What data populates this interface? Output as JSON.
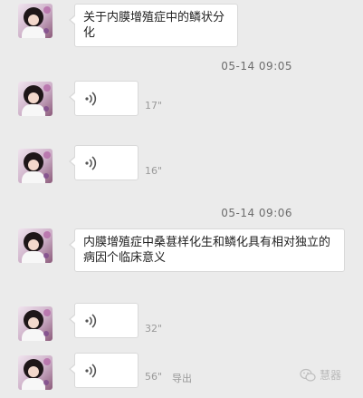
{
  "messages": [
    {
      "type": "text",
      "text": "关于内膜增殖症中的鳞状分化"
    },
    {
      "type": "timestamp",
      "text": "05-14 09:05"
    },
    {
      "type": "voice",
      "duration": "17\""
    },
    {
      "type": "voice",
      "duration": "16\""
    },
    {
      "type": "timestamp",
      "text": "05-14 09:06"
    },
    {
      "type": "text",
      "text": "内膜增殖症中桑葚样化生和鳞化具有相对独立的病因个临床意义"
    },
    {
      "type": "voice",
      "duration": "32\""
    },
    {
      "type": "voice",
      "duration": "56\"",
      "extra_label": "导出"
    }
  ],
  "watermark": {
    "text": "慧器"
  },
  "colors": {
    "background": "#ebebeb",
    "bubble": "#ffffff",
    "border": "#d9d9d9",
    "meta_text": "#9a9a9a"
  },
  "icons": {
    "voice": "voice-wave-icon",
    "watermark": "wechat-logo-icon",
    "avatar": "user-avatar"
  }
}
